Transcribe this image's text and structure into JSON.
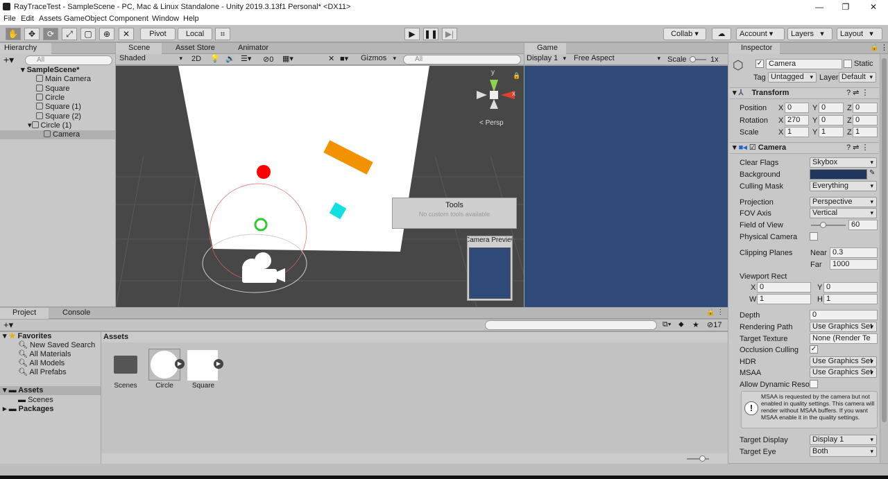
{
  "window": {
    "title": "RayTraceTest - SampleScene - PC, Mac & Linux Standalone - Unity 2019.3.13f1 Personal* <DX11>"
  },
  "menu": [
    "File",
    "Edit",
    "Assets",
    "GameObject",
    "Component",
    "Window",
    "Help"
  ],
  "toolbar": {
    "pivot": "Pivot",
    "local": "Local",
    "collab": "Collab ▾",
    "account": "Account",
    "layers": "Layers",
    "layout": "Layout"
  },
  "hierarchy": {
    "tab": "Hierarchy",
    "search": "All",
    "scene": "SampleScene*",
    "items": [
      "Main Camera",
      "Square",
      "Circle",
      "Square (1)",
      "Square (2)",
      "Circle (1)",
      "Camera"
    ]
  },
  "scene": {
    "tabs": [
      "Scene",
      "Asset Store",
      "Animator"
    ],
    "shading": "Shaded",
    "mode2d": "2D",
    "fx_count": "0",
    "gizmos": "Gizmos",
    "search": "All",
    "persp": "< Persp",
    "axis_y": "y",
    "axis_x": "x",
    "tools_title": "Tools",
    "tools_msg": "No custom tools available",
    "camera_preview": "Camera Preview"
  },
  "game": {
    "tab": "Game",
    "display": "Display 1",
    "aspect": "Free Aspect",
    "scale_label": "Scale",
    "scale_value": "1x"
  },
  "inspector": {
    "tab": "Inspector",
    "name": "Camera",
    "static": "Static",
    "tag_label": "Tag",
    "tag": "Untagged",
    "layer_label": "Layer",
    "layer": "Default",
    "transform": {
      "title": "Transform",
      "position": {
        "label": "Position",
        "x": "0",
        "y": "0",
        "z": "0"
      },
      "rotation": {
        "label": "Rotation",
        "x": "270",
        "y": "0",
        "z": "0"
      },
      "scale": {
        "label": "Scale",
        "x": "1",
        "y": "1",
        "z": "1"
      }
    },
    "camera": {
      "title": "Camera",
      "clear_flags_label": "Clear Flags",
      "clear_flags": "Skybox",
      "background_label": "Background",
      "culling_label": "Culling Mask",
      "culling": "Everything",
      "projection_label": "Projection",
      "projection": "Perspective",
      "fov_axis_label": "FOV Axis",
      "fov_axis": "Vertical",
      "fov_label": "Field of View",
      "fov": "60",
      "physical_label": "Physical Camera",
      "clip_label": "Clipping Planes",
      "near_label": "Near",
      "near": "0.3",
      "far_label": "Far",
      "far": "1000",
      "viewport_label": "Viewport Rect",
      "vx": "0",
      "vy": "0",
      "vw": "1",
      "vh": "1",
      "depth_label": "Depth",
      "depth": "0",
      "rpath_label": "Rendering Path",
      "rpath": "Use Graphics Set",
      "ttex_label": "Target Texture",
      "ttex": "None (Render Te",
      "occl_label": "Occlusion Culling",
      "hdr_label": "HDR",
      "hdr": "Use Graphics Set",
      "msaa_label": "MSAA",
      "msaa": "Use Graphics Set",
      "dynres_label": "Allow Dynamic Reso",
      "msaa_warning": "MSAA is requested by the camera but not enabled in quality settings. This camera will render without MSAA buffers. If you want MSAA enable it in the quality settings.",
      "tdisplay_label": "Target Display",
      "tdisplay": "Display 1",
      "teye_label": "Target Eye",
      "teye": "Both"
    }
  },
  "project": {
    "tabs": [
      "Project",
      "Console"
    ],
    "favorites": "Favorites",
    "fav_items": [
      "New Saved Search",
      "All Materials",
      "All Models",
      "All Prefabs"
    ],
    "assets": "Assets",
    "asset_children": [
      "Scenes"
    ],
    "packages": "Packages",
    "count": "17",
    "breadcrumb": "Assets",
    "grid": [
      "Scenes",
      "Circle",
      "Square"
    ]
  },
  "colors": {
    "game_bg": "#2f4a79",
    "scene_bg": "#474747"
  }
}
